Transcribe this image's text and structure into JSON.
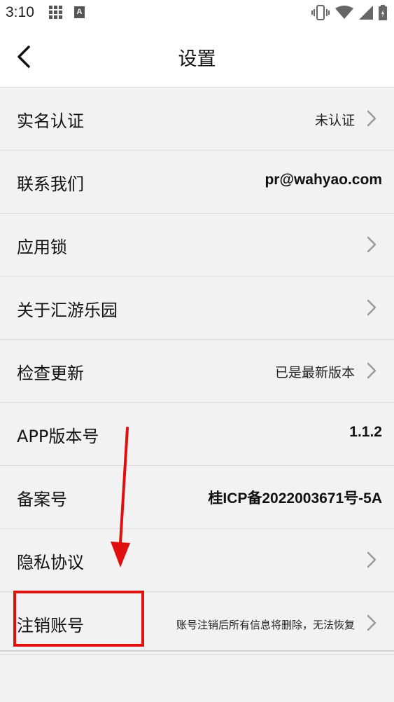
{
  "status_bar": {
    "time": "3:10",
    "badge_letter": "A",
    "icons": [
      "grid-icon",
      "a-badge-icon",
      "vibrate-icon",
      "wifi-icon",
      "cell-signal-icon",
      "battery-icon"
    ]
  },
  "header": {
    "title": "设置",
    "back_icon": "chevron-left-icon"
  },
  "rows": [
    {
      "label": "实名认证",
      "value": "未认证",
      "chevron": true
    },
    {
      "label": "联系我们",
      "value": "pr@wahyao.com",
      "chevron": false
    },
    {
      "label": "应用锁",
      "value": "",
      "chevron": true
    },
    {
      "label": "关于汇游乐园",
      "value": "",
      "chevron": true
    },
    {
      "label": "检查更新",
      "value": "已是最新版本",
      "chevron": true
    },
    {
      "label": "APP版本号",
      "value": "1.1.2",
      "chevron": false
    },
    {
      "label": "备案号",
      "value": "桂ICP备2022003671号-5A",
      "chevron": false
    },
    {
      "label": "隐私协议",
      "value": "",
      "chevron": true
    },
    {
      "label": "注销账号",
      "value": "账号注销后所有信息将删除，无法恢复",
      "chevron": true
    }
  ],
  "annotation": {
    "arrow_color": "#e01010",
    "box_color": "#e01010"
  }
}
